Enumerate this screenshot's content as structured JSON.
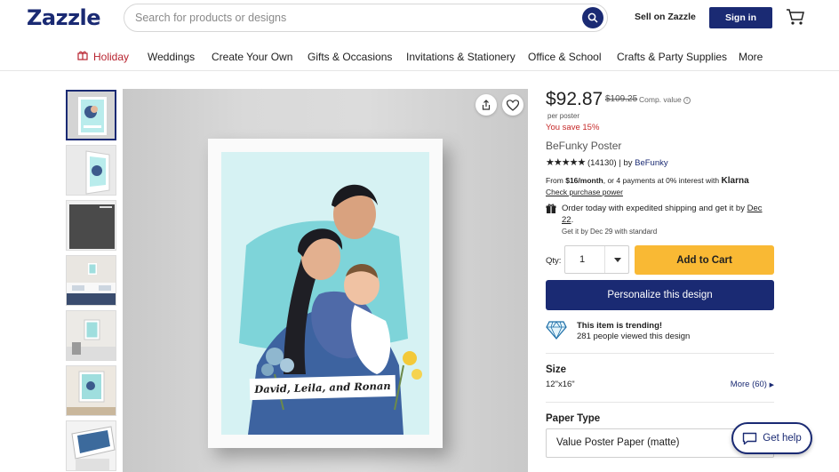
{
  "header": {
    "logo": "Zazzle",
    "search_placeholder": "Search for products or designs",
    "sell_label": "Sell on Zazzle",
    "signin_label": "Sign in"
  },
  "nav": {
    "items": [
      "Holiday",
      "Weddings",
      "Create Your Own",
      "Gifts & Occasions",
      "Invitations & Stationery",
      "Office & School",
      "Crafts & Party Supplies",
      "More"
    ]
  },
  "product": {
    "price": "$92.87",
    "old_price": "$109.25",
    "comp_value": "Comp. value",
    "per_unit": "per poster",
    "savings": "You save 15%",
    "title": "BeFunky Poster",
    "stars": "★★★★★",
    "review_count": "(14130)",
    "by_label": "| by",
    "seller": "BeFunky",
    "klarna_from": "From",
    "klarna_amount": "$16/month",
    "klarna_text": ", or 4 payments at 0% interest with",
    "klarna_brand": "Klarna",
    "klarna_link": "Check purchase power",
    "ship_text": "Order today with expedited shipping and get it by",
    "ship_date": "Dec 22",
    "ship_period": ".",
    "ship_standard": "Get it by Dec 29 with standard",
    "qty_label": "Qty:",
    "qty_value": "1",
    "add_to_cart": "Add to Cart",
    "personalize": "Personalize this design",
    "trending_title": "This item is trending!",
    "trending_sub": "281 people viewed this design",
    "size_label": "Size",
    "size_value": "12\"x16\"",
    "size_more": "More (60)",
    "paper_label": "Paper Type",
    "paper_value": "Value Poster Paper (matte)",
    "image_caption": "David, Leila, and Ronan"
  },
  "help": {
    "label": "Get help"
  },
  "colors": {
    "brand": "#1a2a73",
    "cta": "#f9b934",
    "sale": "#c62828",
    "holiday": "#b8232f"
  }
}
